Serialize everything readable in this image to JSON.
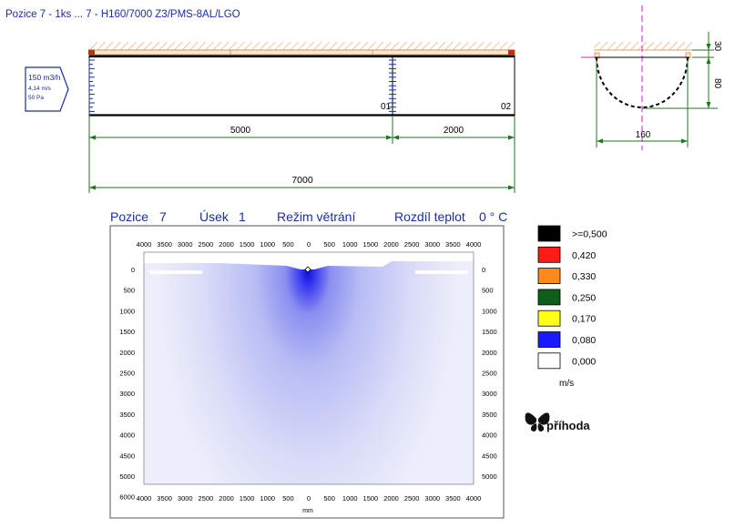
{
  "header": {
    "title": "Pozice 7 - 1ks ... 7 - H160/7000 Z3/PMS-8AL/LGO"
  },
  "inlet": {
    "flow": "150 m3/h",
    "velocity": "4,14 m/s",
    "pressure": "50 Pa"
  },
  "duct": {
    "section_labels": [
      "01",
      "02"
    ],
    "segment_lengths": [
      "5000",
      "2000"
    ],
    "total_length": "7000"
  },
  "cross_section": {
    "gap": "30",
    "height": "80",
    "diameter": "160"
  },
  "plot_header": {
    "pozice_label": "Pozice",
    "pozice_value": "7",
    "usek_label": "Úsek",
    "usek_value": "1",
    "mode": "Režim větrání",
    "temp_label": "Rozdíl teplot",
    "temp_value": "0 ° C"
  },
  "velocity_plot": {
    "x_ticks": [
      "4000",
      "3500",
      "3000",
      "2500",
      "2000",
      "1500",
      "1000",
      "500",
      "0",
      "500",
      "1000",
      "1500",
      "2000",
      "2500",
      "3000",
      "3500",
      "4000"
    ],
    "y_ticks": [
      "0",
      "500",
      "1000",
      "1500",
      "2000",
      "2500",
      "3000",
      "3500",
      "4000",
      "4500",
      "5000"
    ],
    "y_ticks_left": [
      "0",
      "500",
      "1000",
      "1500",
      "2000",
      "2500",
      "3000",
      "3500",
      "4000",
      "4500",
      "5000",
      "6000"
    ],
    "x_unit": "mm"
  },
  "legend": {
    "items": [
      {
        "label": ">=0,500",
        "color": "#000000"
      },
      {
        "label": "0,420",
        "color": "#ff1a1a"
      },
      {
        "label": "0,330",
        "color": "#ff8a1a"
      },
      {
        "label": "0,250",
        "color": "#0e5e1c"
      },
      {
        "label": "0,170",
        "color": "#ffff1a"
      },
      {
        "label": "0,080",
        "color": "#1a1aff"
      },
      {
        "label": "0,000",
        "color": "#ffffff"
      }
    ],
    "unit": "m/s"
  },
  "logo": {
    "text": "příhoda"
  }
}
